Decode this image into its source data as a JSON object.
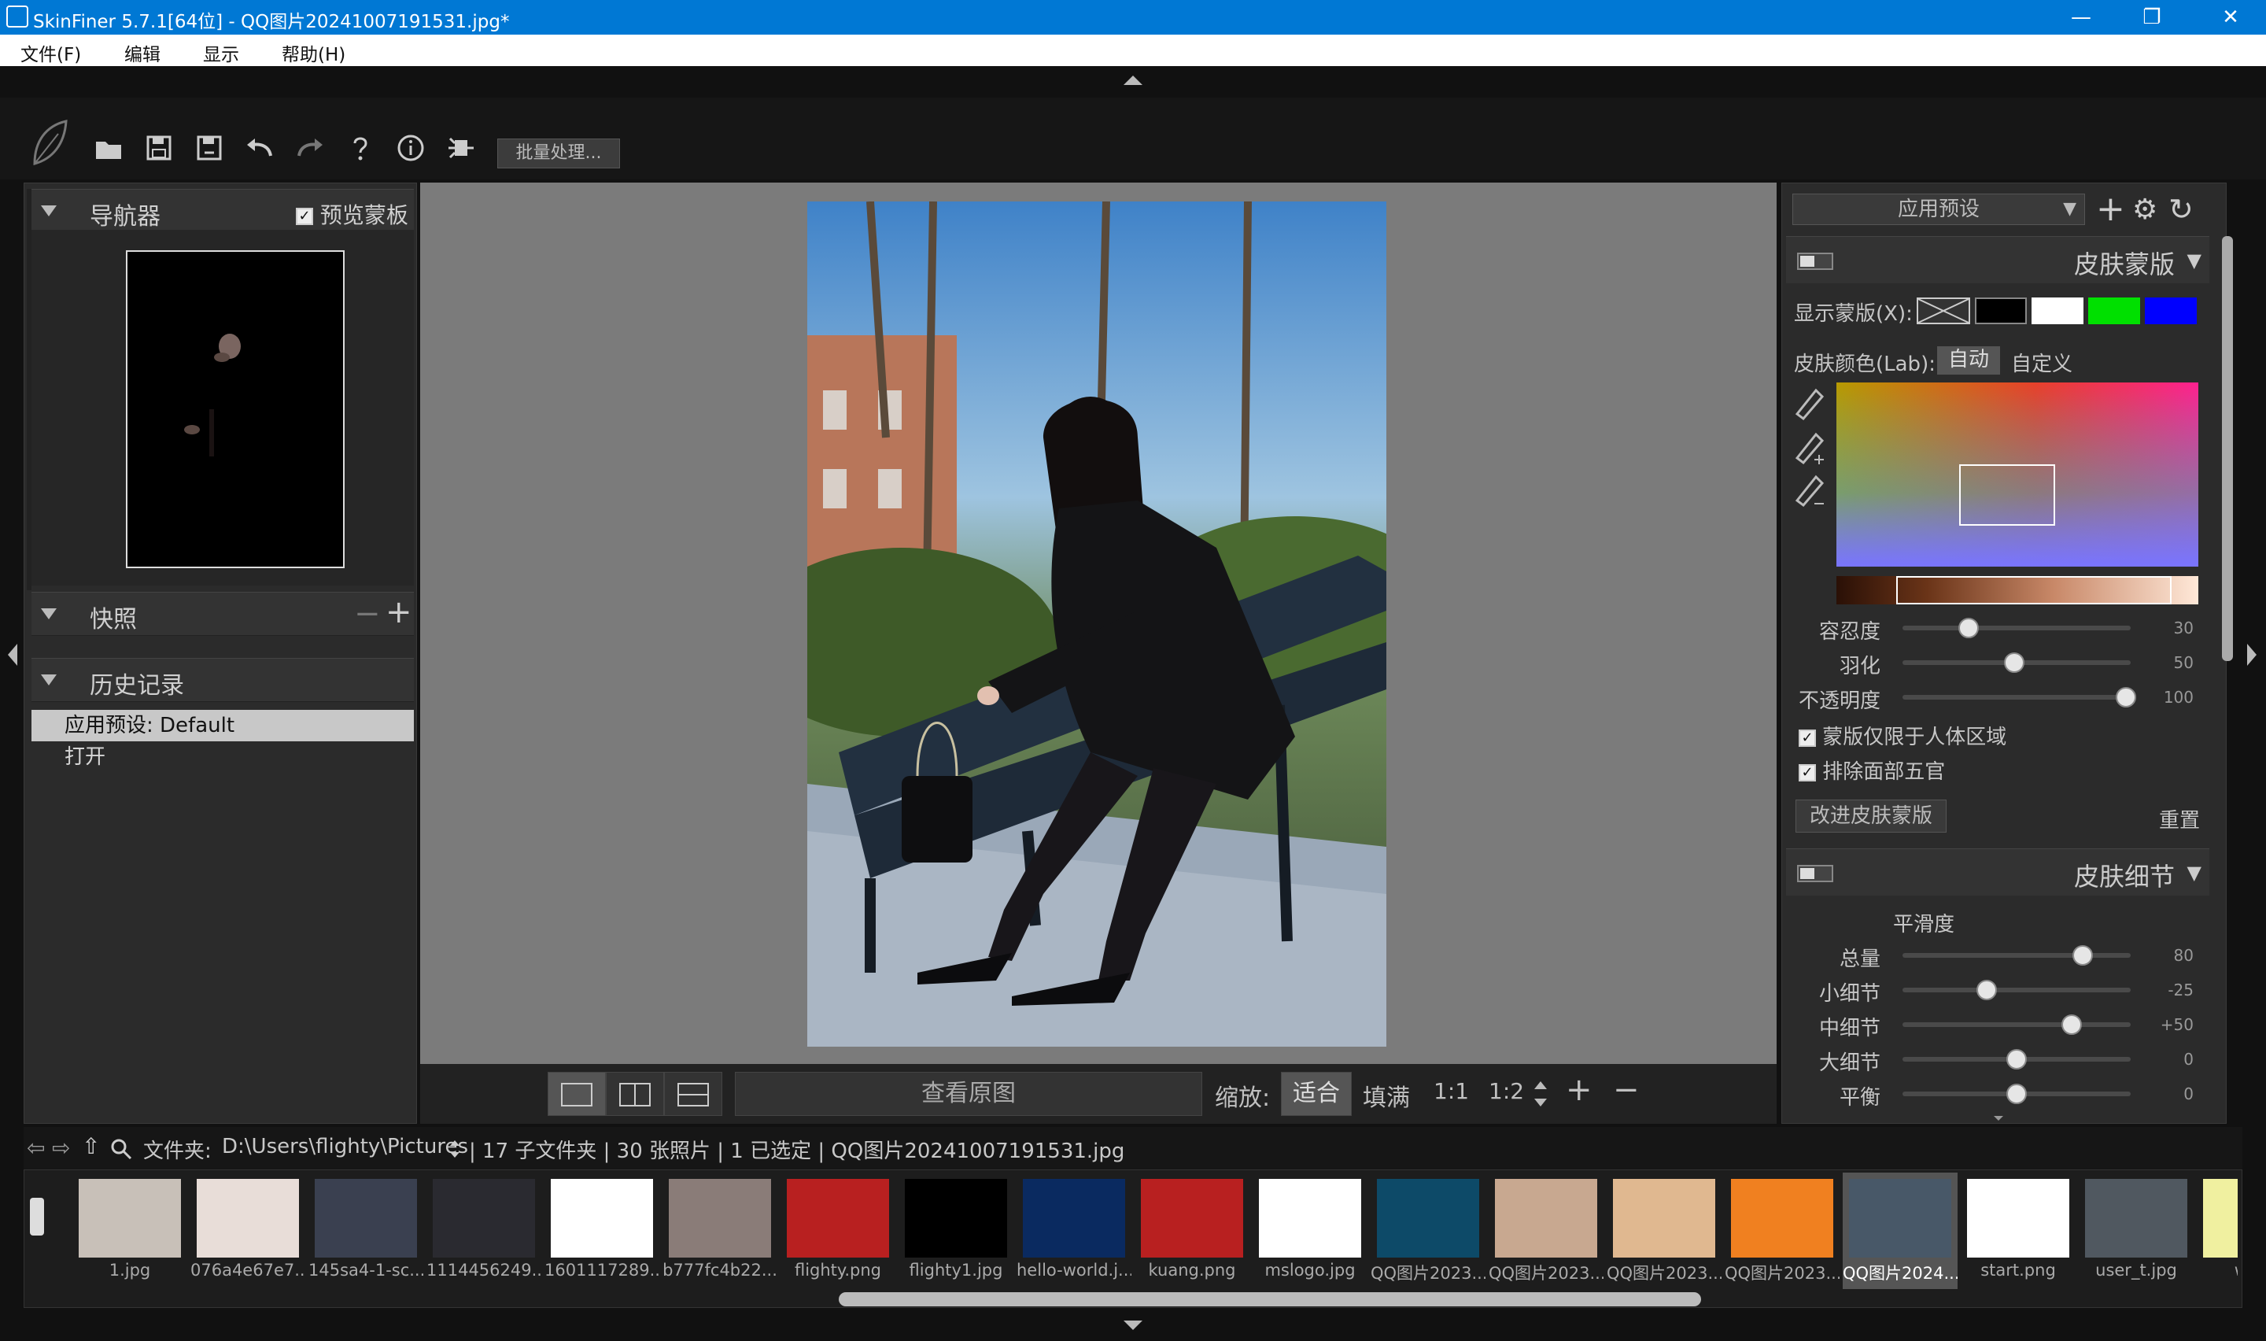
{
  "window": {
    "title": "SkinFiner 5.7.1[64位] - QQ图片20241007191531.jpg*",
    "minimize": "—",
    "restore": "❐",
    "close": "✕"
  },
  "menu": [
    {
      "label": "文件(F)"
    },
    {
      "label": "编辑"
    },
    {
      "label": "显示"
    },
    {
      "label": "帮助(H)"
    }
  ],
  "toolbar": {
    "batch_label": "批量处理..."
  },
  "navigator": {
    "title": "导航器",
    "preview_mask_label": "预览蒙板",
    "preview_mask_checked": true
  },
  "snapshots": {
    "title": "快照"
  },
  "history": {
    "title": "历史记录",
    "items": [
      {
        "label": "应用预设: Default",
        "selected": true
      },
      {
        "label": "打开",
        "selected": false
      }
    ]
  },
  "viewbar": {
    "view_original": "查看原图",
    "zoom_label": "缩放:",
    "fit": "适合",
    "fill": "填满",
    "one_to_one": "1:1",
    "one_to_two": "1:2"
  },
  "presets": {
    "label": "应用预设"
  },
  "skin_mask": {
    "title": "皮肤蒙版",
    "show_mask_label": "显示蒙版(X):",
    "mask_colors": [
      "#000000",
      "#ffffff",
      "#00e000",
      "#0000ff"
    ],
    "skin_color_label": "皮肤颜色(Lab):",
    "auto": "自动",
    "custom": "自定义",
    "sliders": [
      {
        "label": "容忍度",
        "value": "30",
        "fraction": 0.29
      },
      {
        "label": "羽化",
        "value": "50",
        "fraction": 0.49
      },
      {
        "label": "不透明度",
        "value": "100",
        "fraction": 0.98
      }
    ],
    "limit_to_body": "蒙版仅限于人体区域",
    "exclude_face": "排除面部五官",
    "improve_button": "改进皮肤蒙版",
    "reset": "重置"
  },
  "skin_detail": {
    "title": "皮肤细节",
    "smoothness": "平滑度",
    "sliders": [
      {
        "label": "总量",
        "value": "80",
        "fraction": 0.79
      },
      {
        "label": "小细节",
        "value": "-25",
        "fraction": 0.37
      },
      {
        "label": "中细节",
        "value": "+50",
        "fraction": 0.74
      },
      {
        "label": "大细节",
        "value": "0",
        "fraction": 0.5
      },
      {
        "label": "平衡",
        "value": "0",
        "fraction": 0.5
      }
    ]
  },
  "pathbar": {
    "folder_label": "文件夹:",
    "path": "D:\\Users\\flighty\\Pictures",
    "info": "| 17 子文件夹 | 30 张照片 | 1 已选定 | QQ图片20241007191531.jpg"
  },
  "files": [
    {
      "name": "1.jpg",
      "bg": "#c8c0b8"
    },
    {
      "name": "076a4e67e7...",
      "bg": "#e8ddd8"
    },
    {
      "name": "145sa4-1-sc...",
      "bg": "#3a4050"
    },
    {
      "name": "1114456249...",
      "bg": "#2a2a30"
    },
    {
      "name": "1601117289...",
      "bg": "#ffffff"
    },
    {
      "name": "b777fc4b22...",
      "bg": "#8a7c78"
    },
    {
      "name": "flighty.png",
      "bg": "#b82020"
    },
    {
      "name": "flighty1.jpg",
      "bg": "#000000"
    },
    {
      "name": "hello-world.j...",
      "bg": "#0a2a60"
    },
    {
      "name": "kuang.png",
      "bg": "#b82020"
    },
    {
      "name": "mslogo.jpg",
      "bg": "#ffffff"
    },
    {
      "name": "QQ图片2023...",
      "bg": "#0d4a68"
    },
    {
      "name": "QQ图片2023...",
      "bg": "#c8a890"
    },
    {
      "name": "QQ图片2023...",
      "bg": "#e0b890"
    },
    {
      "name": "QQ图片2023...",
      "bg": "#f08020"
    },
    {
      "name": "QQ图片2024...",
      "bg": "#485868",
      "selected": true
    },
    {
      "name": "start.png",
      "bg": "#ffffff"
    },
    {
      "name": "user_t.jpg",
      "bg": "#505860"
    },
    {
      "name": "wu...",
      "bg": "#f0f0a0"
    }
  ]
}
